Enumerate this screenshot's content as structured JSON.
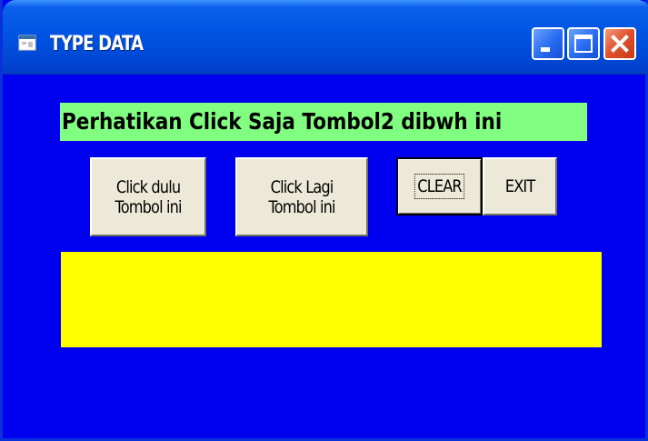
{
  "window": {
    "title": "TYPE DATA",
    "background_color": "#0000F0",
    "icon": "vb-form-icon",
    "controls": {
      "minimize": "minimize-icon",
      "maximize": "maximize-icon",
      "close": "close-icon"
    }
  },
  "form": {
    "heading_label": "Perhatikan Click Saja Tombol2 dibwh ini",
    "heading_background": "#80FF80",
    "buttons": {
      "first": "Click dulu\nTombol ini",
      "second": "Click Lagi\nTombol ini",
      "clear": "CLEAR",
      "exit": "EXIT"
    },
    "output": {
      "text": "",
      "background": "#FFFF00"
    }
  }
}
